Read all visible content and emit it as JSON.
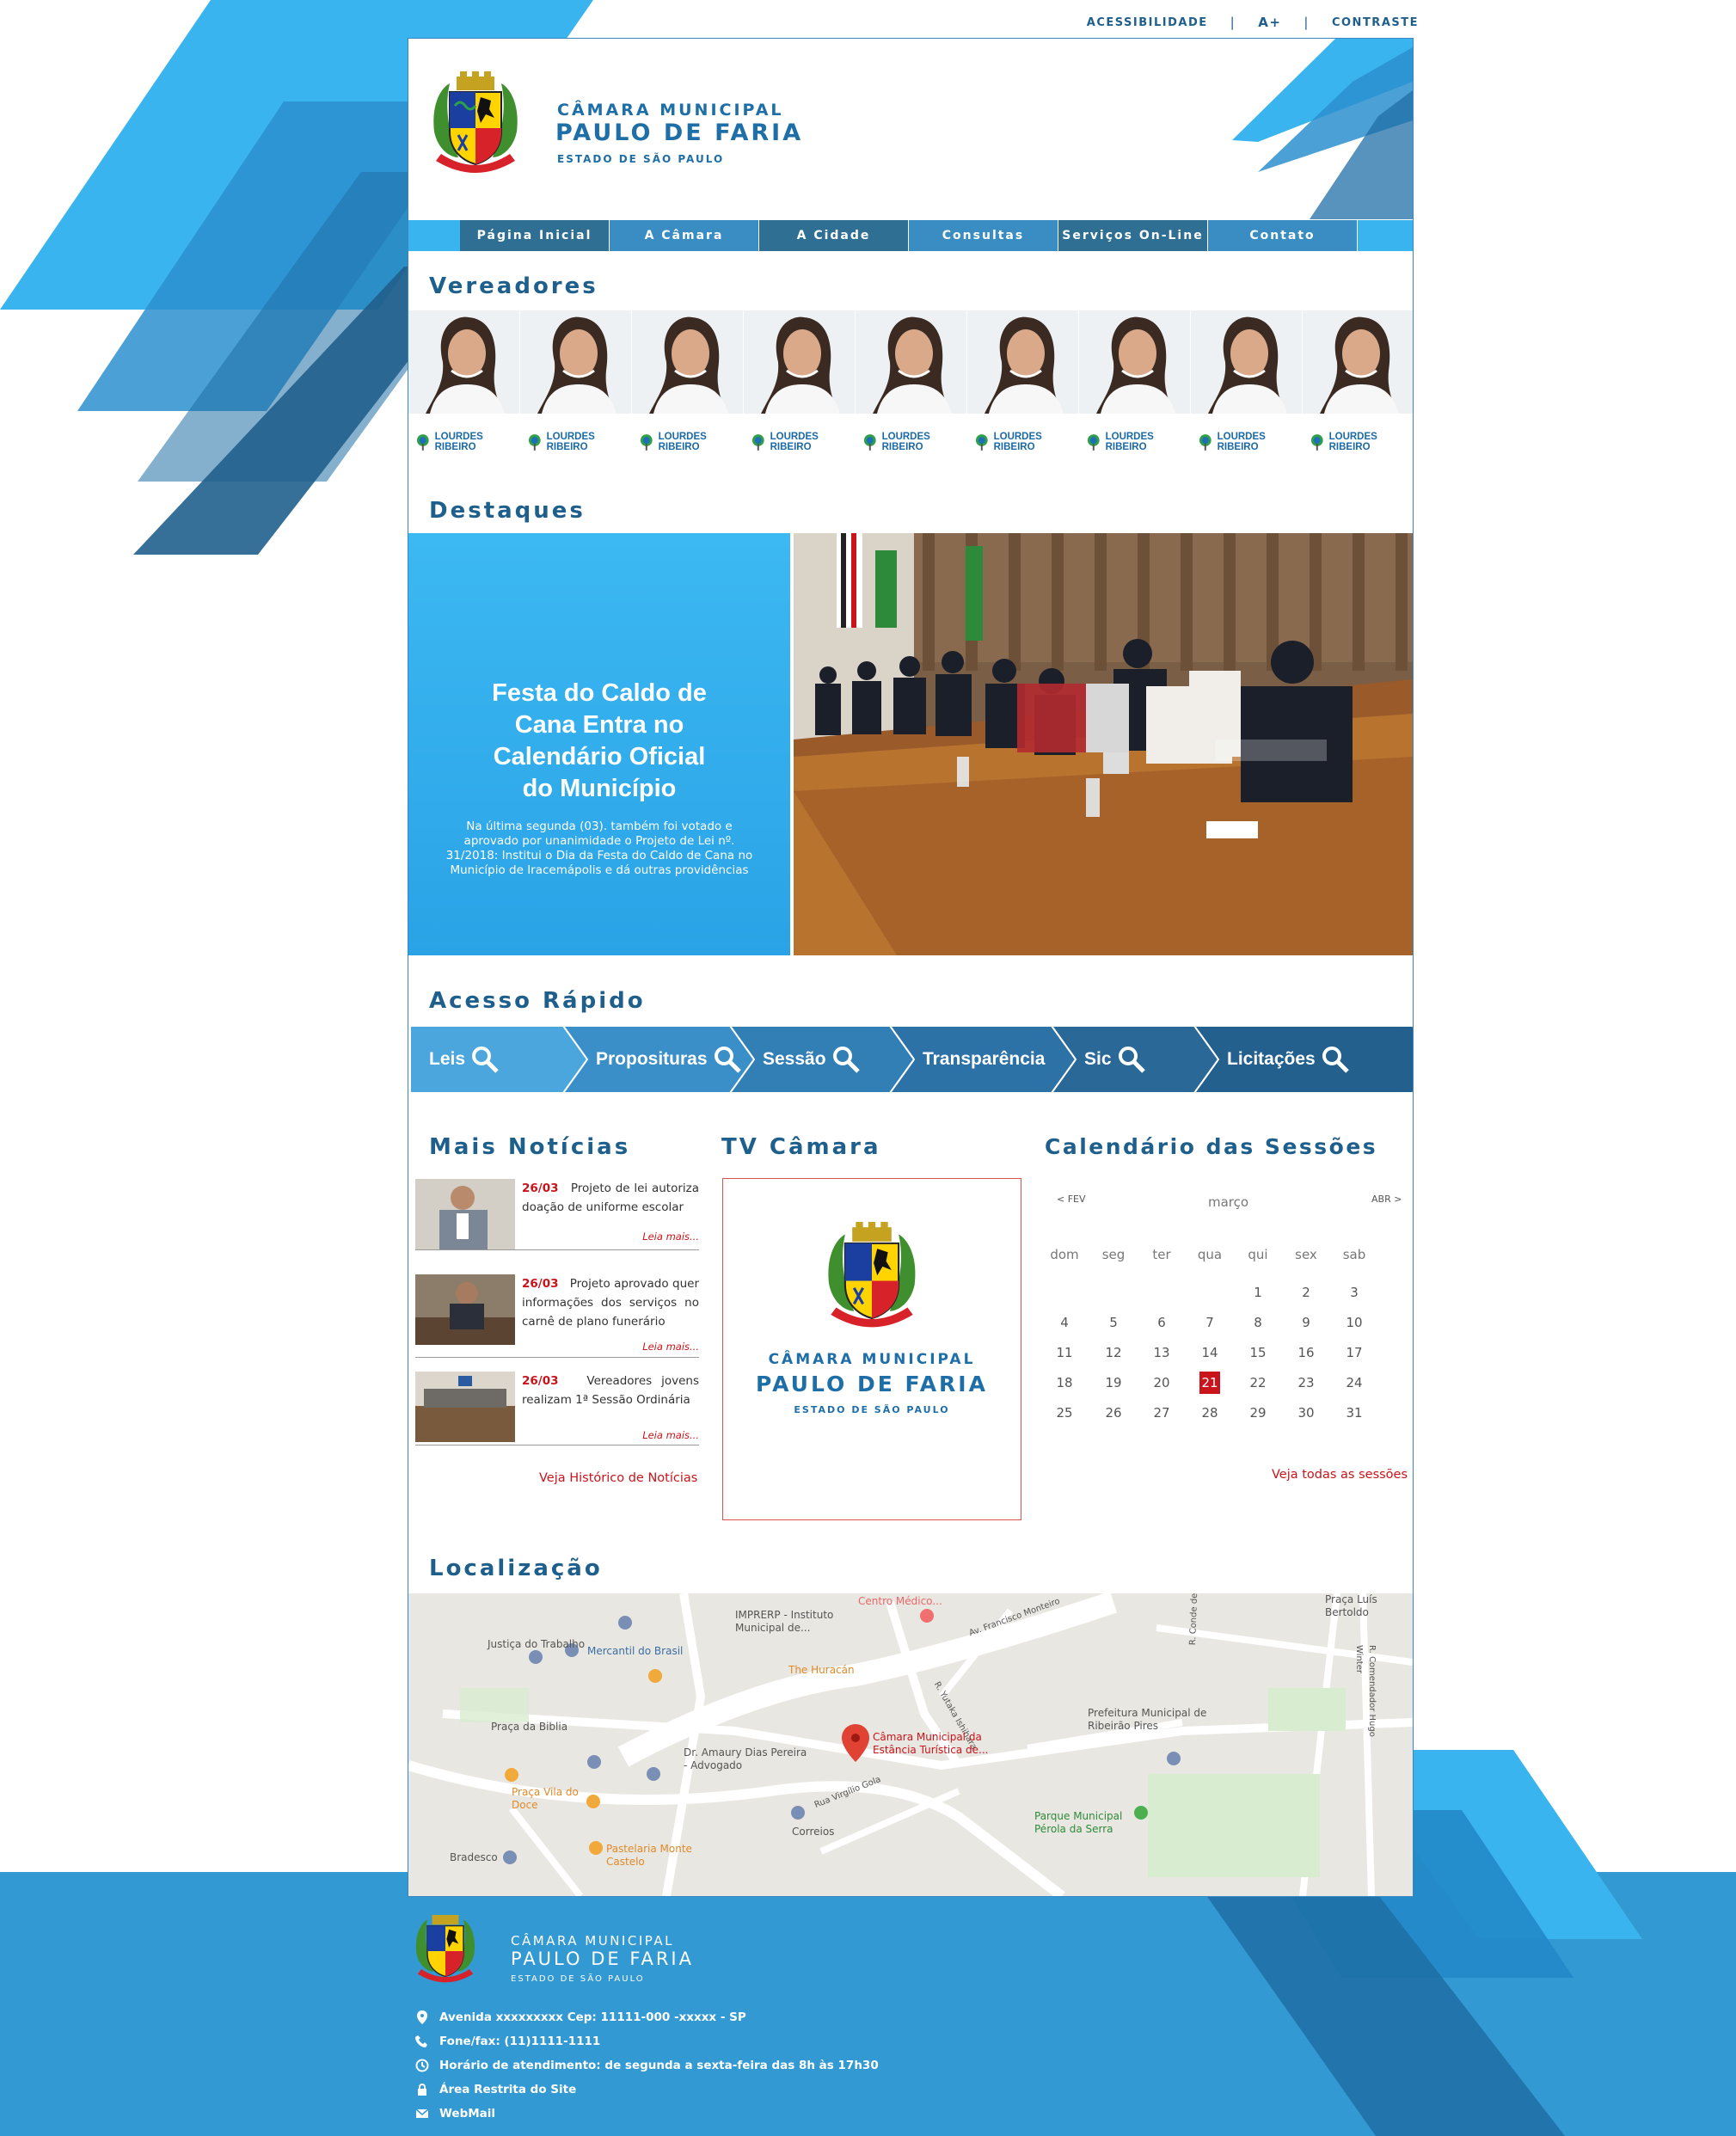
{
  "topbar": {
    "accessibility": "Acessibilidade",
    "font_increase": "A+",
    "contrast": "Contraste",
    "separator": "|"
  },
  "header": {
    "line1": "CÂMARA MUNICIPAL",
    "line2": "PAULO DE FARIA",
    "line3": "ESTADO DE SÃO PAULO"
  },
  "nav": {
    "items": [
      {
        "label": "Página Inicial",
        "color": "#2f6f93"
      },
      {
        "label": "A Câmara",
        "color": "#3a8dc2"
      },
      {
        "label": "A Cidade",
        "color": "#2f6f93"
      },
      {
        "label": "Consultas",
        "color": "#3a8dc2"
      },
      {
        "label": "Serviços On-Line",
        "color": "#2f6f93"
      },
      {
        "label": "Contato",
        "color": "#3a8dc2"
      }
    ]
  },
  "vereadores": {
    "title": "Vereadores",
    "items": [
      {
        "name": "LOURDES RIBEIRO"
      },
      {
        "name": "LOURDES RIBEIRO"
      },
      {
        "name": "LOURDES RIBEIRO"
      },
      {
        "name": "LOURDES RIBEIRO"
      },
      {
        "name": "LOURDES RIBEIRO"
      },
      {
        "name": "LOURDES RIBEIRO"
      },
      {
        "name": "LOURDES RIBEIRO"
      },
      {
        "name": "LOURDES RIBEIRO"
      },
      {
        "name": "LOURDES RIBEIRO"
      }
    ]
  },
  "destaques": {
    "title": "Destaques",
    "headline_lines": [
      "Festa do Caldo de",
      "Cana Entra no",
      "Calendário Oficial",
      "do Município"
    ],
    "summary_lines": [
      "Na última segunda (03). também foi votado e",
      "aprovado por unanimidade o Projeto de Lei nº.",
      "31/2018: Institui o Dia da Festa do Caldo de Cana no",
      "Município de Iracemápolis e dá outras providências"
    ]
  },
  "acesso": {
    "title": "Acesso Rápido",
    "items": [
      {
        "label": "Leis",
        "color": "#4aa6dc"
      },
      {
        "label": "Proposituras",
        "color": "#3a8fc8"
      },
      {
        "label": "Sessão",
        "color": "#327fb6"
      },
      {
        "label": "Transparência",
        "color": "#2d72a6"
      },
      {
        "label": "Sic",
        "color": "#2a6898"
      },
      {
        "label": "Licitações",
        "color": "#23608e"
      }
    ]
  },
  "noticias": {
    "title": "Mais Notícias",
    "items": [
      {
        "date": "26/03",
        "text": "Projeto de lei autoriza doação de uniforme escolar",
        "more": "Leia mais..."
      },
      {
        "date": "26/03",
        "text": "Projeto aprovado quer informações dos serviços no carnê de plano funerário",
        "more": "Leia mais..."
      },
      {
        "date": "26/03",
        "text": "Vereadores jovens realizam 1ª Sessão Ordinária",
        "more": "Leia mais..."
      }
    ],
    "history_link": "Veja Histórico de Notícias"
  },
  "tv": {
    "title": "TV Câmara",
    "line1": "CÂMARA MUNICIPAL",
    "line2": "PAULO DE FARIA",
    "line3": "ESTADO DE SÃO PAULO"
  },
  "calendario": {
    "title": "Calendário das Sessões",
    "prev": "< FEV",
    "next": "ABR >",
    "month": "março",
    "weekdays": [
      "dom",
      "seg",
      "ter",
      "qua",
      "qui",
      "sex",
      "sab"
    ],
    "days": [
      "1",
      "2",
      "3",
      "4",
      "5",
      "6",
      "7",
      "8",
      "9",
      "10",
      "11",
      "12",
      "13",
      "14",
      "15",
      "16",
      "17",
      "18",
      "19",
      "20",
      "21",
      "22",
      "23",
      "24",
      "25",
      "26",
      "27",
      "28",
      "29",
      "30",
      "31"
    ],
    "first_weekday": 4,
    "highlight_day": "21",
    "all_link": "Veja todas as sessões"
  },
  "localizacao": {
    "title": "Localização",
    "labels": [
      {
        "text": "Centro Médico..."
      },
      {
        "text": "Av. Francisco Monteiro"
      },
      {
        "text": "Praça Luís Bertoldo"
      },
      {
        "text": "Justiça do Trabalho"
      },
      {
        "text": "IMPRERP - Instituto Municipal de..."
      },
      {
        "text": "Mercantil do Brasil"
      },
      {
        "text": "The Huracán"
      },
      {
        "text": "R. Conde de Sarzedas"
      },
      {
        "text": "R. Yutaka Ishihara"
      },
      {
        "text": "Praça da Biblia"
      },
      {
        "text": "Câmara Municipal da Estância Turística de..."
      },
      {
        "text": "Prefeitura Municipal de Ribeirão Pires"
      },
      {
        "text": "Dr. Amaury Dias Pereira - Advogado"
      },
      {
        "text": "Praça Vila do Doce"
      },
      {
        "text": "Rua Virgílio Gola"
      },
      {
        "text": "Correios"
      },
      {
        "text": "Parque Municipal Pérola da Serra"
      },
      {
        "text": "Pastelaria Monte Castelo"
      },
      {
        "text": "Bradesco"
      },
      {
        "text": "R. Comendador Hugo Winter"
      }
    ]
  },
  "footer": {
    "line1": "CÂMARA MUNICIPAL",
    "line2": "PAULO DE FARIA",
    "line3": "ESTADO DE SÃO PAULO",
    "address": "Avenida xxxxxxxxx Cep: 11111-000 -xxxxx - SP",
    "phone": "Fone/fax: (11)1111-1111",
    "hours": "Horário de atendimento: de segunda a sexta-feira das 8h às 17h30",
    "restricted": "Área Restrita do Site",
    "webmail": "WebMail"
  },
  "colors": {
    "primary": "#1e5f8c",
    "accent": "#3ab4ee",
    "footer": "#3399d2",
    "red": "#c8141a"
  }
}
